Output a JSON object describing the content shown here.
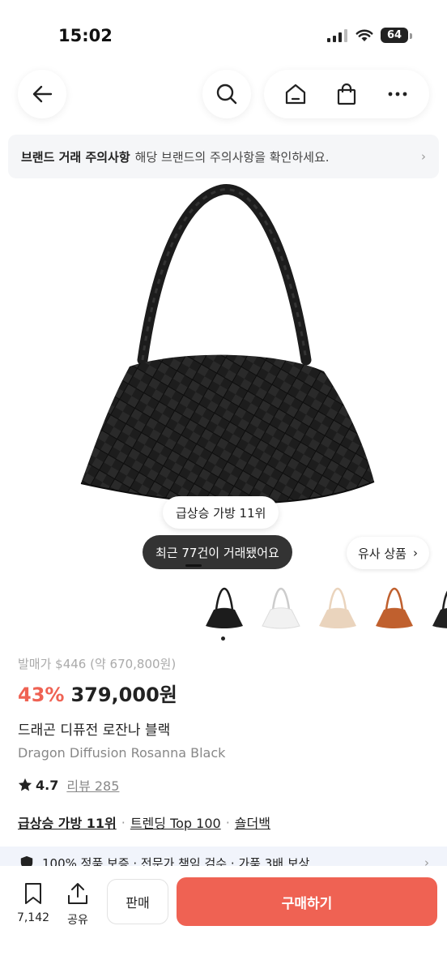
{
  "status": {
    "time": "15:02",
    "battery": "64"
  },
  "nav": {
    "back_icon": "arrow-left-icon",
    "search_icon": "search-icon",
    "home_icon": "home-icon",
    "bag_icon": "shopping-bag-icon",
    "more_icon": "more-icon"
  },
  "notice": {
    "title": "브랜드 거래 주의사항",
    "text": "해당 브랜드의 주의사항을 확인하세요.",
    "arrow": "›"
  },
  "product": {
    "tag_pill": "급상승 가방 11위",
    "recent_trades": "최근 77건이 거래됐어요",
    "similar_label": "유사 상품",
    "similar_arrow": "›",
    "thumbnail_colors": [
      "#1c1c1c",
      "#f1f1f1",
      "#ead4bd",
      "#c0602e",
      "#222222"
    ]
  },
  "info": {
    "release_price": "발매가 $446 (약 670,800원)",
    "discount": "43%",
    "price": "379,000원",
    "name_ko": "드래곤 디퓨전 로잔나 블랙",
    "name_en": "Dragon Diffusion Rosanna Black",
    "rating": "4.7",
    "review_label": "리뷰 285",
    "tags": [
      "급상승 가방 11위",
      "트렌딩 Top 100",
      "숄더백"
    ],
    "separator": "·"
  },
  "banner": {
    "text": "100% 정품 보증 · 전문가 책임 검수 · 가품 3배 보상",
    "arrow": "›"
  },
  "bottom": {
    "bookmark_count": "7,142",
    "share_label": "공유",
    "sell_label": "판매",
    "buy_label": "구매하기"
  },
  "colors": {
    "accent": "#ef6253",
    "dark_pill": "#333333",
    "notice_bg": "#f5f6f8"
  }
}
